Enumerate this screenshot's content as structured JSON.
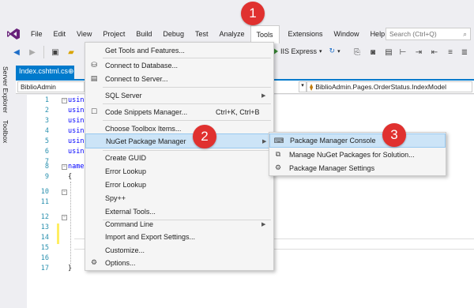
{
  "menubar": {
    "items": [
      "File",
      "Edit",
      "View",
      "Project",
      "Build",
      "Debug",
      "Test",
      "Analyze",
      "Tools",
      "Extensions",
      "Window",
      "Help"
    ],
    "search_placeholder": "Search (Ctrl+Q)"
  },
  "toolbar": {
    "run_target": "IIS Express"
  },
  "side_tabs": {
    "server_explorer": "Server Explorer",
    "toolbox": "Toolbox"
  },
  "document_tab": {
    "title": "Index.cshtml.cs",
    "pin": "⊕"
  },
  "navbar": {
    "project": "BiblioAdmin",
    "class": "BiblioAdmin.Pages.OrderStatus.IndexModel"
  },
  "editor": {
    "line_numbers": [
      "1",
      "2",
      "3",
      "4",
      "5",
      "6",
      "7",
      "8",
      "9",
      "10",
      "11",
      "12",
      "13",
      "14",
      "15",
      "16",
      "17"
    ],
    "code": {
      "using": "using",
      "usings_partial": [
        "usin",
        "usin",
        "usin",
        "usin"
      ],
      "namespace": "name",
      "open_brace": "{",
      "close_brace": "}"
    }
  },
  "tools_menu": {
    "get_tools": "Get Tools and Features...",
    "connect_db": "Connect to Database...",
    "connect_server": "Connect to Server...",
    "sql_server": "SQL Server",
    "code_snippets": "Code Snippets Manager...",
    "code_snippets_shortcut": "Ctrl+K, Ctrl+B",
    "choose_toolbox": "Choose Toolbox Items...",
    "nuget": "NuGet Package Manager",
    "create_guid": "Create GUID",
    "error_lookup_1": "Error Lookup",
    "error_lookup_2": "Error Lookup",
    "spy": "Spy++",
    "external_tools": "External Tools...",
    "command_line": "Command Line",
    "import_export": "Import and Export Settings...",
    "customize": "Customize...",
    "options": "Options..."
  },
  "nuget_submenu": {
    "console": "Package Manager Console",
    "manage": "Manage NuGet Packages for Solution...",
    "settings": "Package Manager Settings"
  },
  "badges": {
    "one": "1",
    "two": "2",
    "three": "3"
  },
  "colors": {
    "accent": "#007acc",
    "badge": "#e0312f",
    "highlight": "#cce4f7"
  }
}
